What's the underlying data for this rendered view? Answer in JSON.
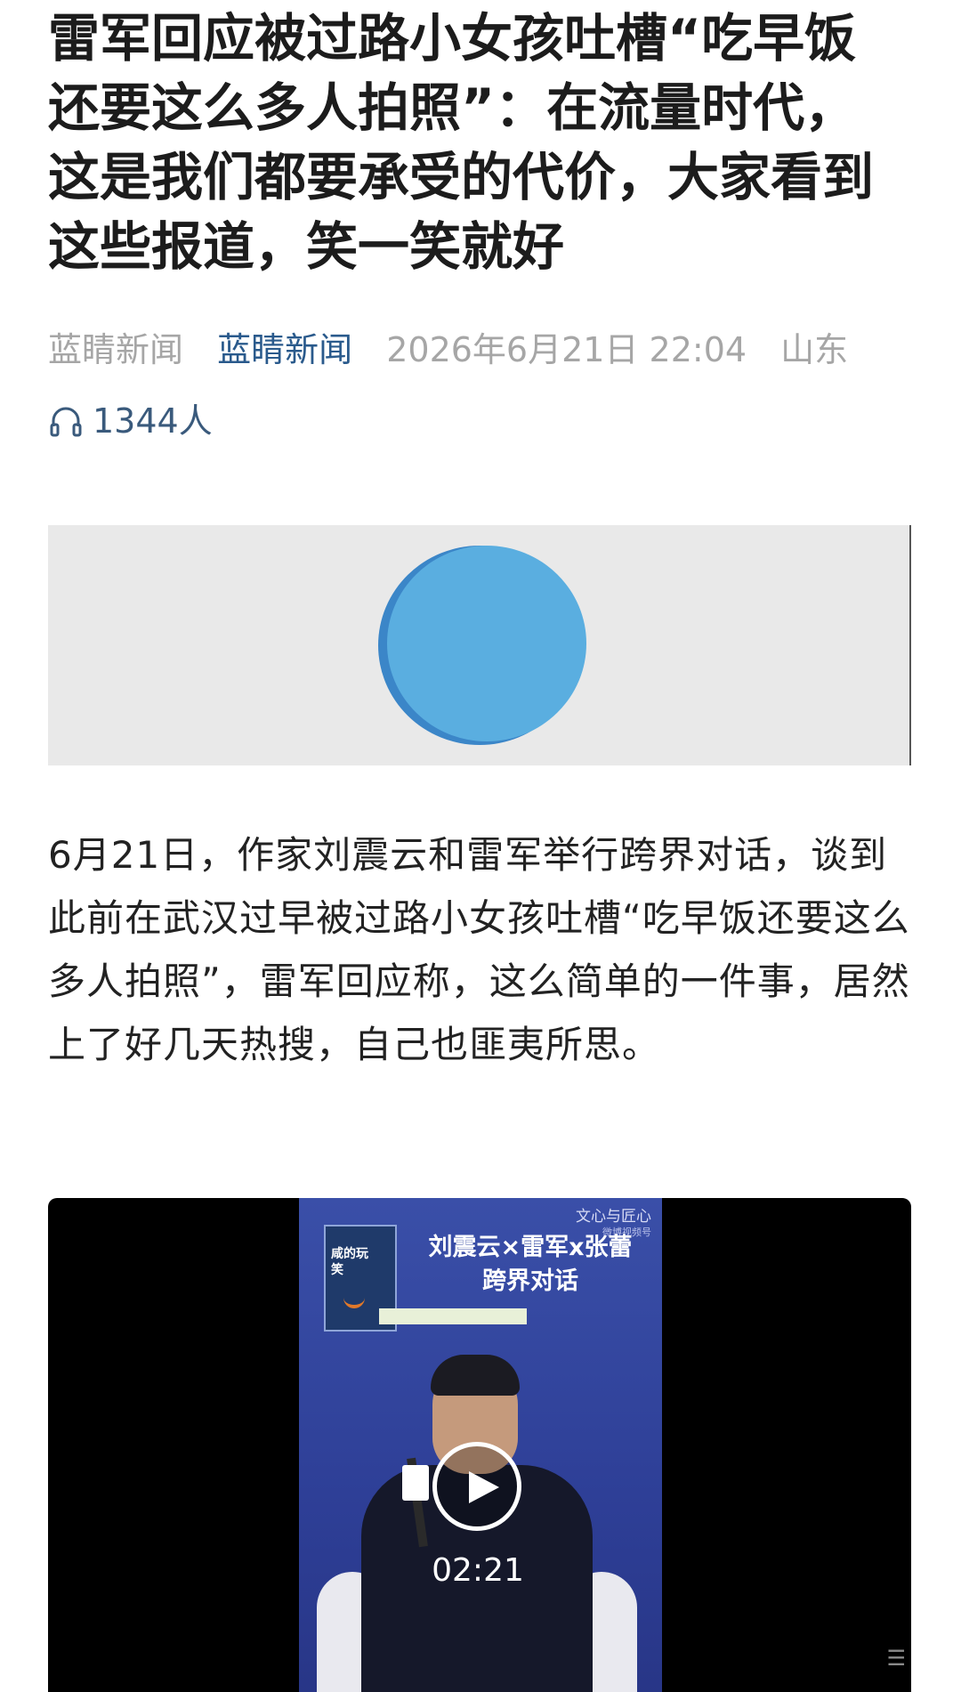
{
  "article": {
    "title": "雷军回应被过路小女孩吐槽“吃早饭还要这么多人拍照”：在流量时代，这是我们都要承受的代价，大家看到这些报道，笑一笑就好",
    "source": "蓝睛新闻",
    "author": "蓝睛新闻",
    "datetime": "2026年6月21日 22:04",
    "location": "山东",
    "listen_count": "1344人",
    "paragraph": "6月21日，作家刘震云和雷军举行跨界对话，谈到此前在武汉过早被过路小女孩吐槽“吃早饭还要这么多人拍照”，雷军回应称，这么简单的一件事，居然上了好几天热搜，自己也匪夷所思。"
  },
  "video": {
    "watermark_top": "文心与匠心",
    "watermark_platform": "微博视频号",
    "banner_line1": "刘震云×雷军x张蕾",
    "banner_line2": "跨界对话",
    "book_title": "咸的玩笑",
    "duration": "02:21"
  },
  "icons": {
    "listen": "headphones-icon",
    "play": "play-icon",
    "audio": "audio-disc-icon"
  },
  "colors": {
    "author_link": "#2a5a8c",
    "meta_gray": "#a6a6a6",
    "audio_disc": "#5aaee0"
  }
}
